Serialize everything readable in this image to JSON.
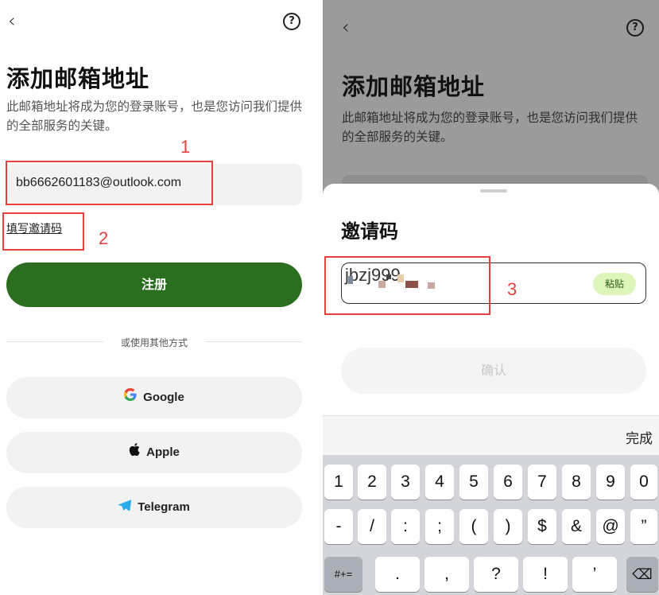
{
  "left": {
    "back_glyph": "‹",
    "help_glyph": "?",
    "title": "添加邮箱地址",
    "description": "此邮箱地址将成为您的登录账号，也是您访问我们提供的全部服务的关键。",
    "email_value": "bb6662601183@outlook.com",
    "invite_link": "填写邀请码",
    "register_label": "注册",
    "divider_text": "或使用其他方式",
    "social": {
      "google": "Google",
      "apple": "Apple",
      "telegram": "Telegram"
    }
  },
  "annotations": {
    "n1": "1",
    "n2": "2",
    "n3": "3"
  },
  "right": {
    "back_glyph": "‹",
    "help_glyph": "?",
    "title": "添加邮箱地址",
    "description": "此邮箱地址将成为您的登录账号，也是您访问我们提供的全部服务的关键。",
    "sheet": {
      "title": "邀请码",
      "code_value": "jbzj999",
      "paste_label": "粘贴",
      "confirm_label": "确认"
    },
    "keyboard": {
      "done_label": "完成",
      "row1": [
        "1",
        "2",
        "3",
        "4",
        "5",
        "6",
        "7",
        "8",
        "9",
        "0"
      ],
      "row2": [
        "-",
        "/",
        ":",
        ";",
        "(",
        ")",
        "$",
        "&",
        "@",
        "”"
      ],
      "row3": [
        "#+=",
        ".",
        ",",
        "?",
        "!",
        "’",
        "⌫"
      ]
    }
  },
  "colors": {
    "primary_green": "#2b6e1f",
    "annotation_red": "#e8413d",
    "paste_bg": "#ddf5bb",
    "overlay_gray": "#9b9b9b"
  },
  "icons": {
    "google": "google-icon",
    "apple": "apple-icon",
    "telegram": "telegram-icon",
    "backspace": "backspace-icon",
    "help": "help-icon",
    "back": "back-icon"
  }
}
